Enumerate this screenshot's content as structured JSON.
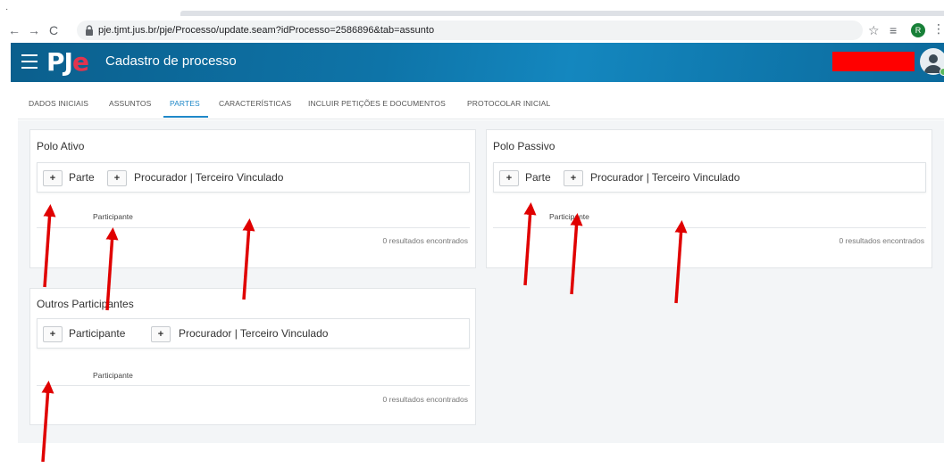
{
  "browser": {
    "url": "pje.tjmt.jus.br/pje/Processo/update.seam?idProcesso=2586896&tab=assunto",
    "profile_initial": "R"
  },
  "app": {
    "logo_main": "PJ",
    "logo_accent": "e",
    "page_title": "Cadastro de processo"
  },
  "tabs": [
    {
      "label": "DADOS INICIAIS"
    },
    {
      "label": "ASSUNTOS"
    },
    {
      "label": "PARTES"
    },
    {
      "label": "CARACTERÍSTICAS"
    },
    {
      "label": "INCLUIR PETIÇÕES E DOCUMENTOS"
    },
    {
      "label": "PROTOCOLAR INICIAL"
    }
  ],
  "active_tab": "PARTES",
  "panels": {
    "polo_ativo": {
      "title": "Polo Ativo",
      "add_label": "+",
      "parte_label": "Parte",
      "procurador_label": "Procurador | Terceiro Vinculado",
      "column": "Participante",
      "results": "0 resultados encontrados"
    },
    "polo_passivo": {
      "title": "Polo Passivo",
      "add_label": "+",
      "parte_label": "Parte",
      "procurador_label": "Procurador | Terceiro Vinculado",
      "column": "Participante",
      "results": "0 resultados encontrados"
    },
    "outros": {
      "title": "Outros Participantes",
      "add_label": "+",
      "parte_label": "Participante",
      "procurador_label": "Procurador | Terceiro Vinculado",
      "column": "Participante",
      "results": "0 resultados encontrados"
    }
  },
  "colors": {
    "header_blue": "#0e74a8",
    "accent_tab": "#1f88c8",
    "logo_accent": "#e3344e",
    "annotation_arrow": "#e00000",
    "redaction": "#ff0000"
  }
}
